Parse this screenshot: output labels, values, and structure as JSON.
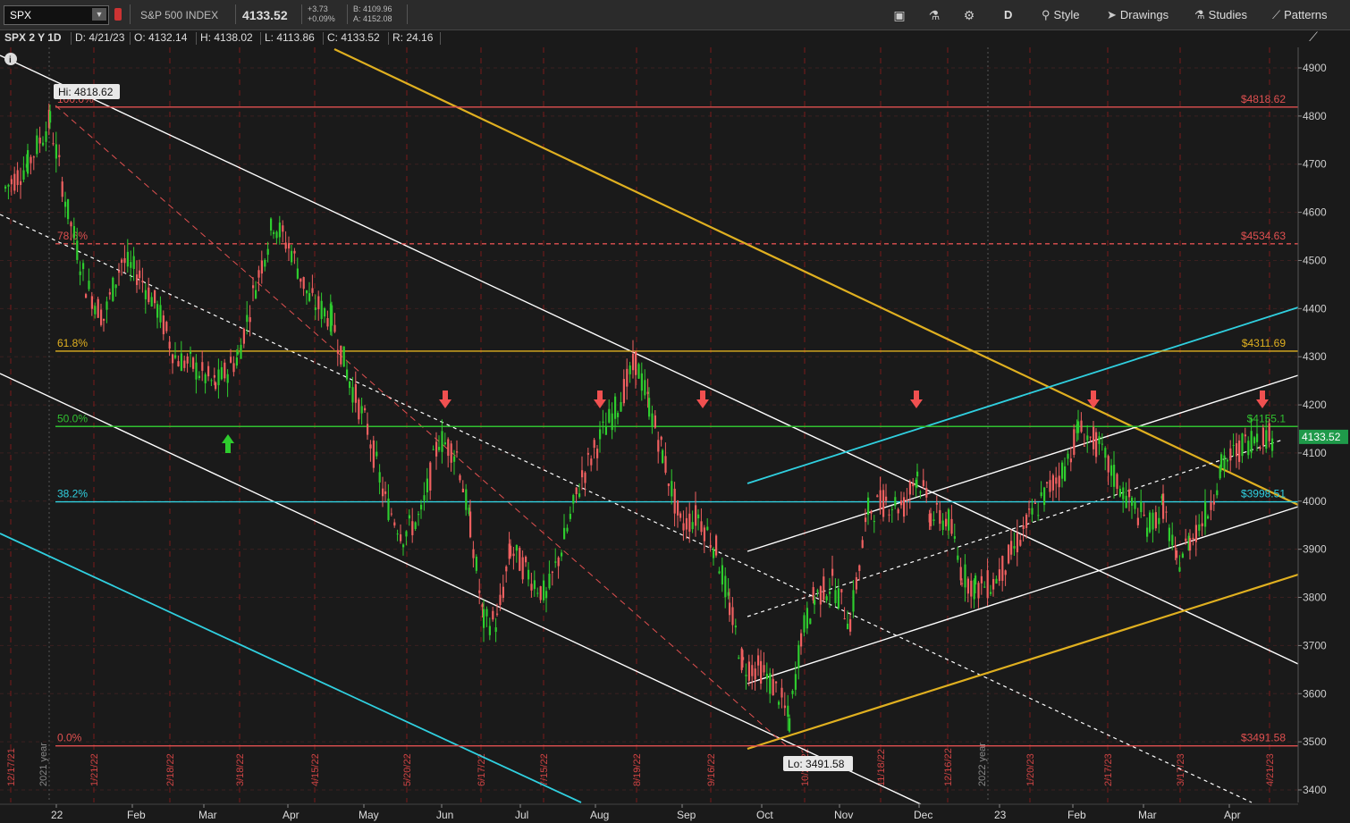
{
  "toolbar": {
    "symbol": "SPX",
    "name": "S&P 500 INDEX",
    "last": "4133.52",
    "change": "+3.73",
    "change_pct": "+0.09%",
    "bid": "B: 4109.96",
    "ask": "A: 4152.08",
    "interval_btn": "D",
    "style_btn": "Style",
    "drawings_btn": "Drawings",
    "studies_btn": "Studies",
    "patterns_btn": "Patterns"
  },
  "info": {
    "title": "SPX 2 Y 1D",
    "date": "D: 4/21/23",
    "open": "O: 4132.14",
    "high": "H: 4138.02",
    "low": "L: 4113.86",
    "close": "C: 4133.52",
    "range": "R: 24.16"
  },
  "chart_data": {
    "type": "candlestick",
    "price_axis": {
      "min": 3400,
      "max": 4900,
      "ticks": [
        "4900",
        "4800",
        "4700",
        "4600",
        "4500",
        "4400",
        "4300",
        "4200",
        "4100",
        "4000",
        "3900",
        "3800",
        "3700",
        "3600",
        "3500",
        "3400"
      ]
    },
    "x_axis_labels": [
      "22",
      "Feb",
      "Mar",
      "Apr",
      "May",
      "Jun",
      "Jul",
      "Aug",
      "Sep",
      "Oct",
      "Nov",
      "Dec",
      "23",
      "Feb",
      "Mar",
      "Apr"
    ],
    "year_labels": [
      "2021 year",
      "2022 year"
    ],
    "vertical_date_labels": [
      "12/17/21",
      "1/21/22",
      "2/18/22",
      "3/18/22",
      "4/15/22",
      "5/20/22",
      "6/17/22",
      "7/15/22",
      "8/19/22",
      "9/16/22",
      "10/21/22",
      "11/18/22",
      "12/16/22",
      "1/20/23",
      "2/17/23",
      "3/17/23",
      "4/21/23"
    ],
    "hi_marker": "Hi: 4818.62",
    "lo_marker": "Lo: 3491.58",
    "last_price_tag": "4133.52",
    "fib_levels": [
      {
        "pct": "100.0%",
        "price": 4818.62,
        "label": "$4818.62",
        "color": "#e05050"
      },
      {
        "pct": "78.6%",
        "price": 4534.63,
        "label": "$4534.63",
        "color": "#e05050"
      },
      {
        "pct": "61.8%",
        "price": 4311.69,
        "label": "$4311.69",
        "color": "#e0b020"
      },
      {
        "pct": "50.0%",
        "price": 4155.1,
        "label": "$4155.1",
        "color": "#30c030"
      },
      {
        "pct": "38.2%",
        "price": 3998.51,
        "label": "$3998.51",
        "color": "#30d0e0"
      },
      {
        "pct": "0.0%",
        "price": 3491.58,
        "label": "$3491.58",
        "color": "#e05050"
      }
    ],
    "colors": {
      "up": "#2ecc2e",
      "down": "#f06060",
      "background": "#1a1a1a",
      "grid": "#7a1a1a"
    }
  }
}
